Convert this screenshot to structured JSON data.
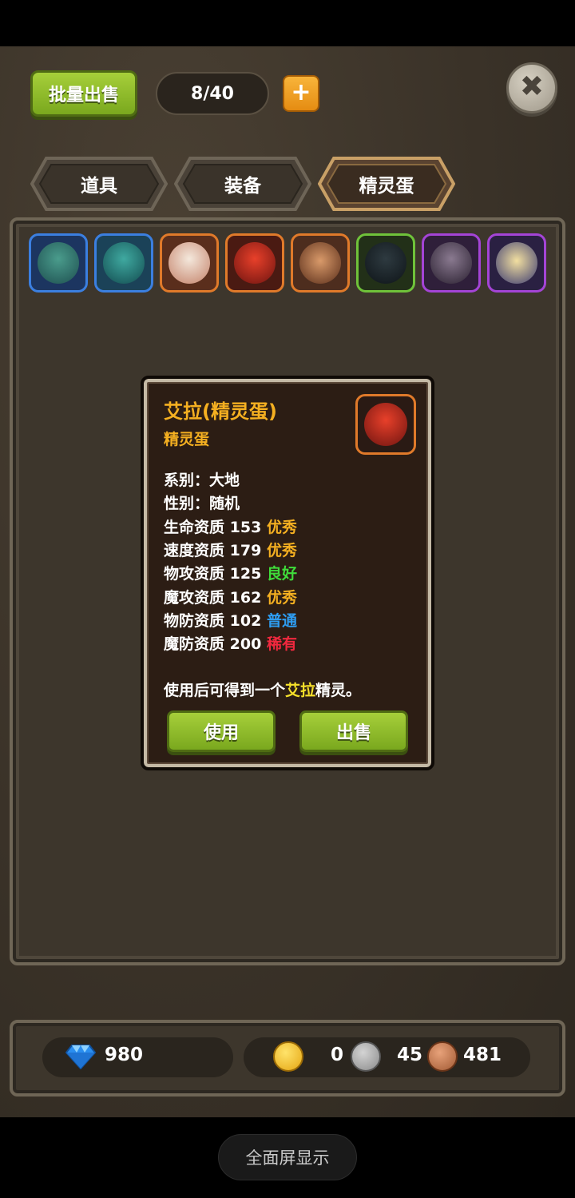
{
  "header": {
    "bulk_sell_label": "批量出售",
    "capacity": "8/40",
    "add_icon": "plus-icon",
    "close_icon": "close-icon"
  },
  "tabs": [
    {
      "label": "道具",
      "active": false
    },
    {
      "label": "装备",
      "active": false
    },
    {
      "label": "精灵蛋",
      "active": true
    }
  ],
  "inventory": {
    "slots": [
      {
        "border": "#3b7fe0",
        "bg": "#1c3560",
        "icon": "blue-creature-icon"
      },
      {
        "border": "#3b7fe0",
        "bg": "#1b4258",
        "icon": "teal-creature-icon"
      },
      {
        "border": "#e07a2a",
        "bg": "#5a2e1c",
        "icon": "white-ball-creature-icon"
      },
      {
        "border": "#e07a2a",
        "bg": "#4a1a12",
        "icon": "red-dragon-icon"
      },
      {
        "border": "#e07a2a",
        "bg": "#4d2d1e",
        "icon": "brown-hero-icon"
      },
      {
        "border": "#6fc23a",
        "bg": "#223018",
        "icon": "black-bird-icon"
      },
      {
        "border": "#a444d6",
        "bg": "#2f1f3a",
        "icon": "shadow-beast-icon"
      },
      {
        "border": "#a444d6",
        "bg": "#2a2042",
        "icon": "witch-girl-icon"
      }
    ]
  },
  "popup": {
    "title": "艾拉(精灵蛋)",
    "subtitle": "精灵蛋",
    "icon": "red-dragon-icon",
    "stats": [
      {
        "label": "系别：",
        "value": "大地",
        "grade": "",
        "grade_color": ""
      },
      {
        "label": "性别：",
        "value": "随机",
        "grade": "",
        "grade_color": ""
      },
      {
        "label": "生命资质",
        "value": "153",
        "grade": "优秀",
        "grade_color": "#f5b021"
      },
      {
        "label": "速度资质",
        "value": "179",
        "grade": "优秀",
        "grade_color": "#f5b021"
      },
      {
        "label": "物攻资质",
        "value": "125",
        "grade": "良好",
        "grade_color": "#3fdc3a"
      },
      {
        "label": "魔攻资质",
        "value": "162",
        "grade": "优秀",
        "grade_color": "#f5b021"
      },
      {
        "label": "物防资质",
        "value": "102",
        "grade": "普通",
        "grade_color": "#2e9cf0"
      },
      {
        "label": "魔防资质",
        "value": "200",
        "grade": "稀有",
        "grade_color": "#f0283e"
      }
    ],
    "desc_prefix": "使用后可得到一个",
    "desc_highlight": "艾拉",
    "desc_suffix": "精灵。",
    "use_label": "使用",
    "sell_label": "出售"
  },
  "currency": {
    "gems": "980",
    "gold": "0",
    "silver": "45",
    "bronze": "481",
    "gem_icon": "diamond-icon",
    "gold_icon": "gold-crown-coin-icon",
    "silver_icon": "silver-crown-coin-icon",
    "bronze_icon": "bronze-crown-coin-icon"
  },
  "system": {
    "fullscreen_label": "全面屏显示"
  }
}
